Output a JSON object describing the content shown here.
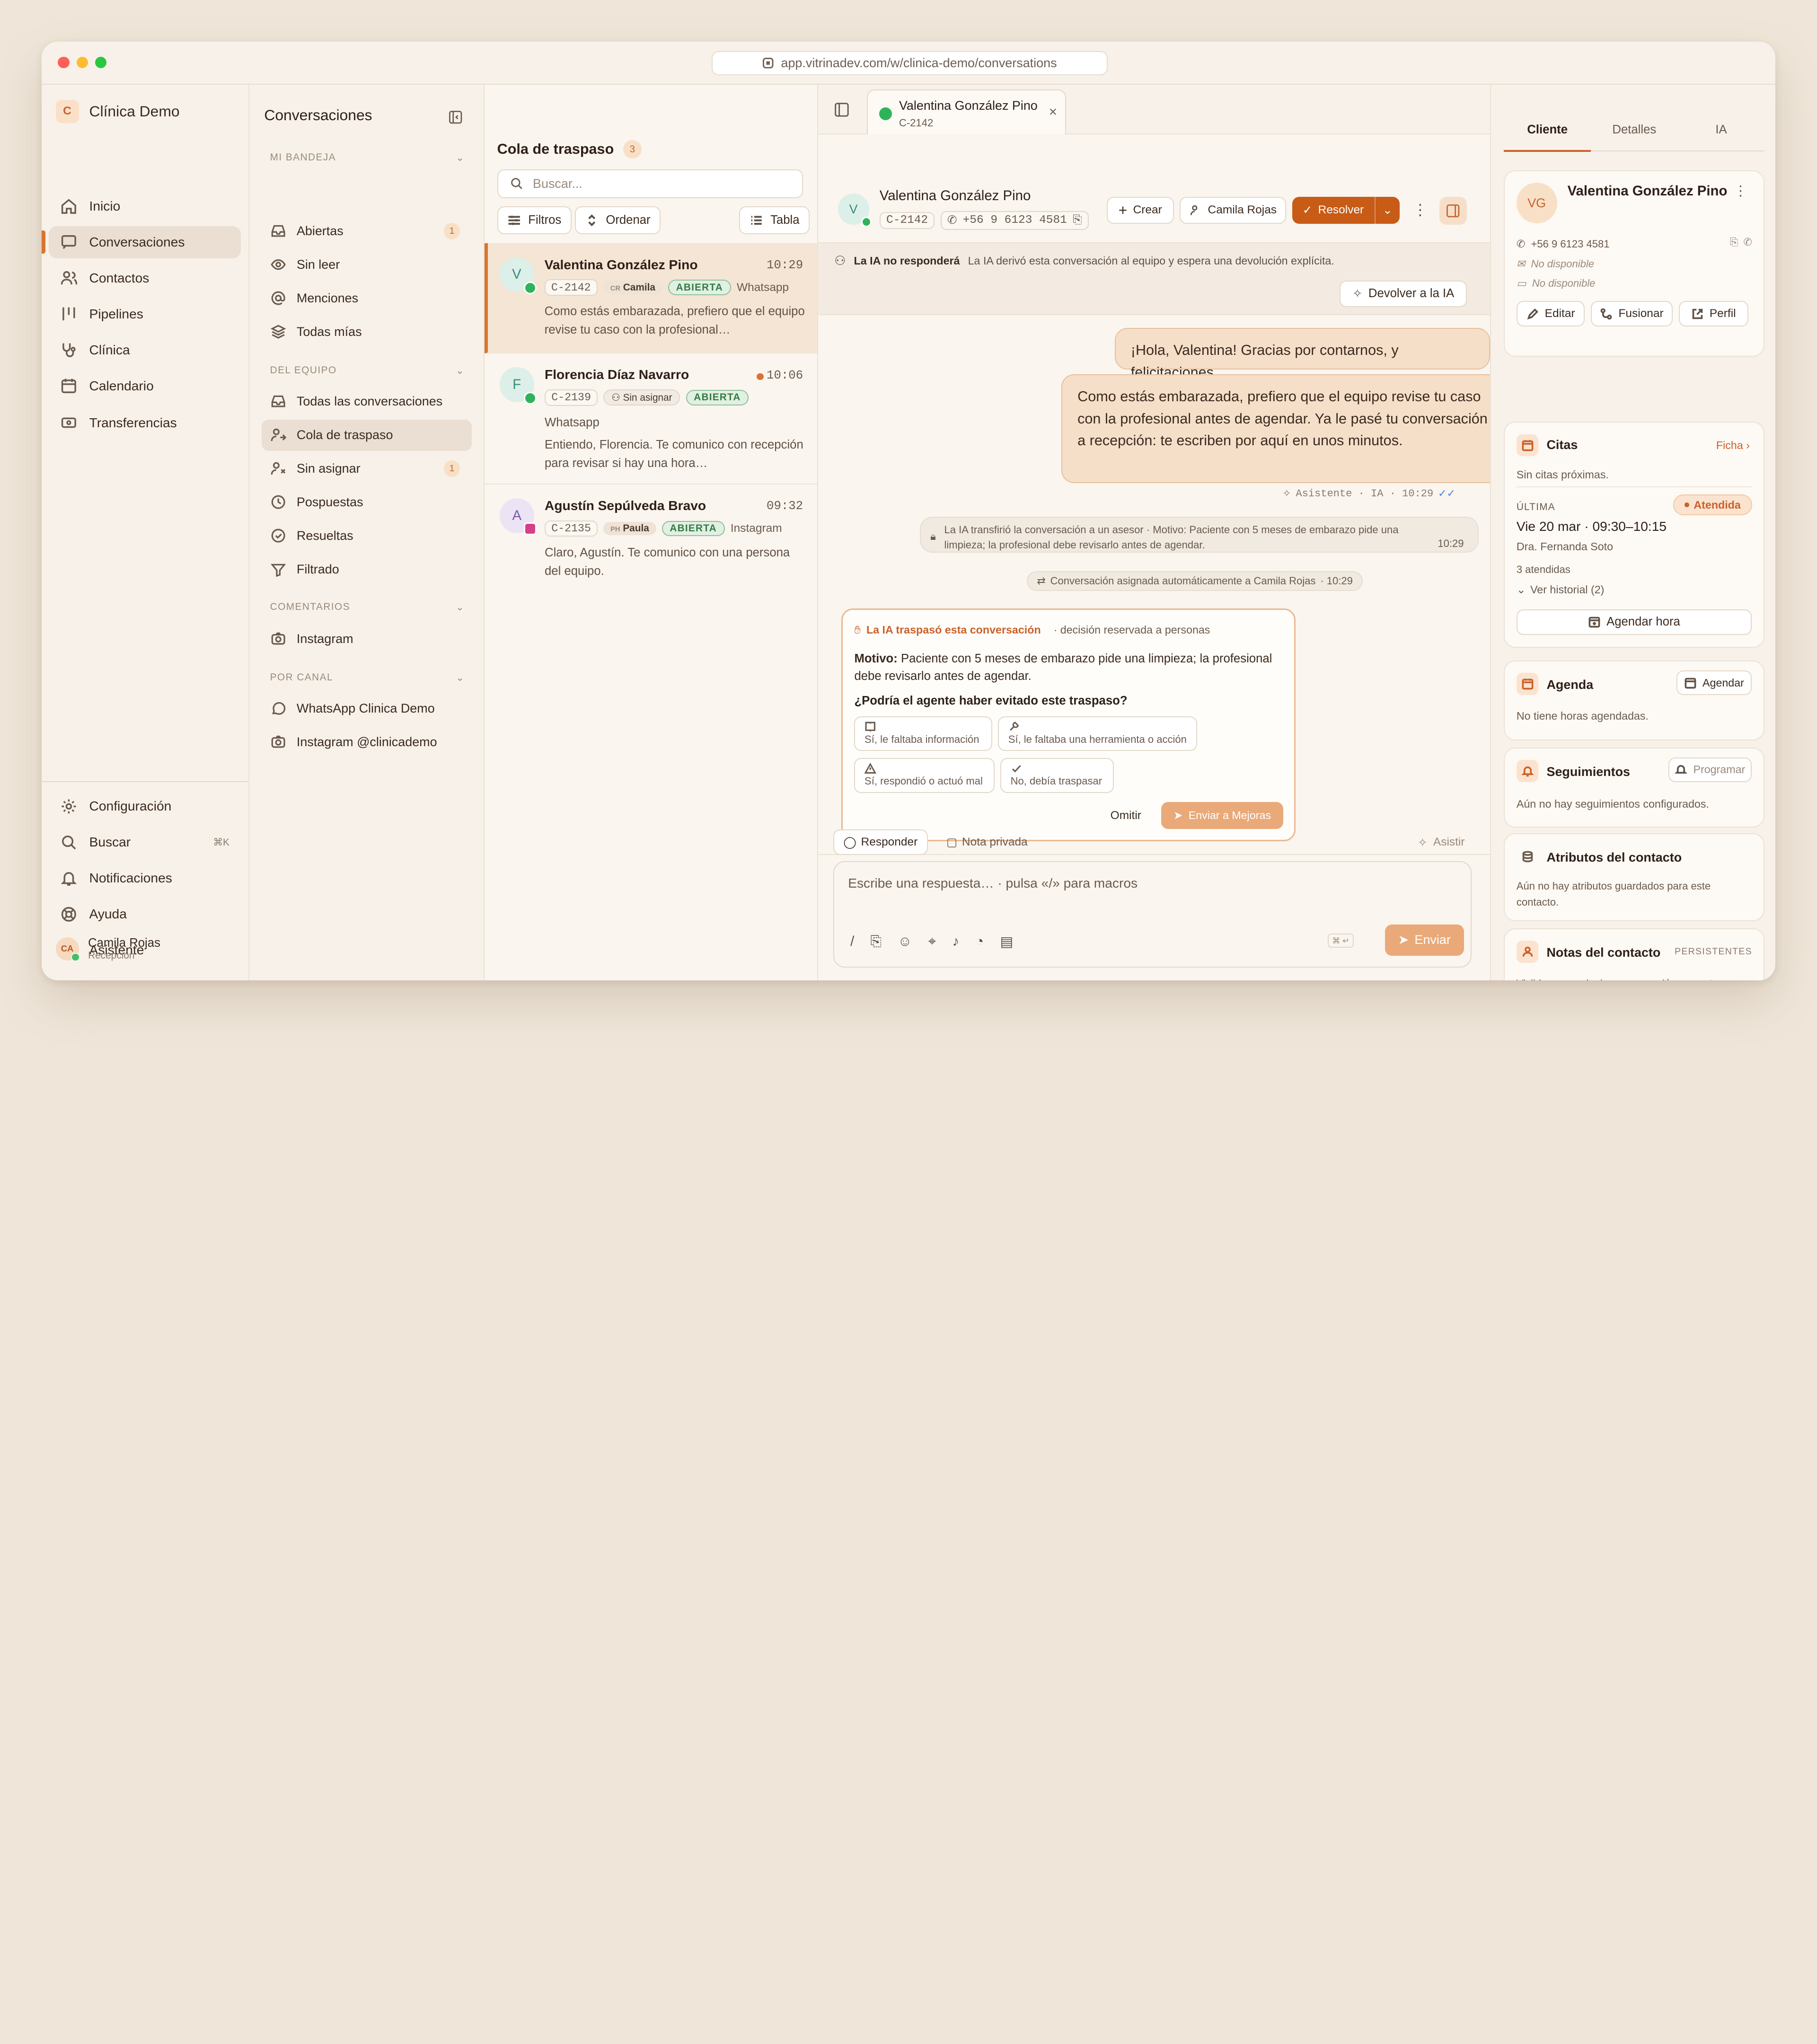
{
  "browser": {
    "url": "app.vitrinadev.com/w/clinica-demo/conversations"
  },
  "workspace": {
    "initial": "C",
    "name": "Clínica Demo"
  },
  "nav": {
    "items": [
      {
        "label": "Inicio"
      },
      {
        "label": "Conversaciones"
      },
      {
        "label": "Contactos"
      },
      {
        "label": "Pipelines"
      },
      {
        "label": "Clínica"
      },
      {
        "label": "Calendario"
      },
      {
        "label": "Transferencias"
      }
    ],
    "bottom": [
      {
        "label": "Configuración"
      },
      {
        "label": "Buscar",
        "shortcut": "⌘K"
      },
      {
        "label": "Notificaciones"
      },
      {
        "label": "Ayuda"
      },
      {
        "label": "Asistente"
      }
    ],
    "user": {
      "initials": "CA",
      "name": "Camila Rojas",
      "role": "Recepción"
    }
  },
  "inbox": {
    "title": "Conversaciones",
    "sections": [
      {
        "title": "MI BANDEJA"
      },
      {
        "title": "DEL EQUIPO"
      },
      {
        "title": "COMENTARIOS"
      },
      {
        "title": "POR CANAL"
      }
    ],
    "mine": [
      {
        "label": "Abiertas",
        "count": "1"
      },
      {
        "label": "Sin leer"
      },
      {
        "label": "Menciones"
      },
      {
        "label": "Todas mías"
      }
    ],
    "team": [
      {
        "label": "Todas las conversaciones"
      },
      {
        "label": "Cola de traspaso"
      },
      {
        "label": "Sin asignar",
        "count": "1"
      },
      {
        "label": "Pospuestas"
      },
      {
        "label": "Resueltas"
      },
      {
        "label": "Filtrado"
      }
    ],
    "comments": [
      {
        "label": "Instagram"
      }
    ],
    "channels": [
      {
        "label": "WhatsApp Clinica Demo"
      },
      {
        "label": "Instagram @clinicademo"
      }
    ]
  },
  "list": {
    "title": "Cola de traspaso",
    "count": "3",
    "search_placeholder": "Buscar...",
    "filters": "Filtros",
    "sort": "Ordenar",
    "view": "Tabla",
    "items": [
      {
        "initial": "V",
        "name": "Valentina González Pino",
        "time": "10:29",
        "id": "C-2142",
        "assignee": "Camila",
        "assignee_initials": "CR",
        "status": "ABIERTA",
        "channel": "Whatsapp",
        "preview": "Como estás embarazada, prefiero que el equipo revise tu caso con la profesional…"
      },
      {
        "initial": "F",
        "name": "Florencia Díaz Navarro",
        "time": "10:06",
        "id": "C-2139",
        "assignee": "Sin asignar",
        "status": "ABIERTA",
        "channel": "Whatsapp",
        "preview": "Entiendo, Florencia. Te comunico con recepción para revisar si hay una hora…"
      },
      {
        "initial": "A",
        "name": "Agustín Sepúlveda Bravo",
        "time": "09:32",
        "id": "C-2135",
        "assignee": "Paula",
        "assignee_initials": "PH",
        "status": "ABIERTA",
        "channel": "Instagram",
        "preview": "Claro, Agustín. Te comunico con una persona del equipo."
      }
    ]
  },
  "chat": {
    "tab": {
      "name": "Valentina González Pino",
      "id": "C-2142"
    },
    "header": {
      "initial": "V",
      "name": "Valentina González Pino",
      "id": "C-2142",
      "phone": "+56 9 6123 4581",
      "create": "Crear",
      "assignee": "Camila Rojas",
      "resolve": "Resolver"
    },
    "banner": {
      "title": "La IA no responderá",
      "text": "La IA derivó esta conversación al equipo y espera una devolución explícita.",
      "button": "Devolver a la IA"
    },
    "messages": [
      {
        "text": "¡Hola, Valentina! Gracias por contarnos, y felicitaciones."
      },
      {
        "text": "Como estás embarazada, prefiero que el equipo revise tu caso con la profesional antes de agendar. Ya le pasé tu conversación a recepción: te escriben por aquí en unos minutos."
      }
    ],
    "meta": "Asistente · IA · 10:29",
    "transfer": {
      "text": "La IA transfirió la conversación a un asesor · Motivo: Paciente con 5 meses de embarazo pide una limpieza; la profesional debe revisarlo antes de agendar.",
      "time": "10:29"
    },
    "assigned": {
      "text": "Conversación asignada automáticamente a Camila Rojas",
      "time": "· 10:29"
    },
    "handoff": {
      "title": "La IA traspasó esta conversación",
      "subtitle": "· decisión reservada a personas",
      "reason_label": "Motivo:",
      "reason": "Paciente con 5 meses de embarazo pide una limpieza; la profesional debe revisarlo antes de agendar.",
      "question": "¿Podría el agente haber evitado este traspaso?",
      "options": [
        {
          "label": "Sí, le faltaba información"
        },
        {
          "label": "Sí, le faltaba una herramienta o acción"
        },
        {
          "label": "Sí, respondió o actuó mal"
        },
        {
          "label": "No, debía traspasar"
        }
      ],
      "skip": "Omitir",
      "send": "Enviar a Mejoras"
    },
    "composer": {
      "tab_reply": "Responder",
      "tab_note": "Nota privada",
      "assist": "Asistir",
      "placeholder": "Escribe una respuesta…  ·  pulsa «/» para macros",
      "send": "Enviar"
    }
  },
  "contact": {
    "tabs": [
      "Cliente",
      "Detalles",
      "IA"
    ],
    "initials": "VG",
    "name": "Valentina González Pino",
    "phone": "+56 9 6123 4581",
    "email": "No disponible",
    "document": "No disponible",
    "edit": "Editar",
    "merge": "Fusionar",
    "profile": "Perfil",
    "citas": {
      "title": "Citas",
      "link": "Ficha",
      "empty": "Sin citas próximas.",
      "last_label": "ÚLTIMA",
      "status": "Atendida",
      "date": "Vie 20 mar · 09:30–10:15",
      "doctor": "Dra. Fernanda Soto",
      "attended": "3 atendidas",
      "history": "Ver historial (2)",
      "book": "Agendar hora"
    },
    "agenda": {
      "title": "Agenda",
      "button": "Agendar",
      "empty": "No tiene horas agendadas."
    },
    "followups": {
      "title": "Seguimientos",
      "button": "Programar",
      "empty": "Aún no hay seguimientos configurados."
    },
    "attributes": {
      "title": "Atributos del contacto",
      "empty": "Aún no hay atributos guardados para este contacto."
    },
    "notes": {
      "title": "Notas del contacto",
      "badge": "PERSISTENTES",
      "text": "Visibles en cualquier conversación con este contacto. Pensadas para preferencias o contexto duradero."
    }
  },
  "colors": {
    "accent": "#c9622b",
    "accent_strong": "#c85b15",
    "bubble": "#f6dfc9",
    "open_green": "#357a45",
    "background": "#efe6d9"
  }
}
